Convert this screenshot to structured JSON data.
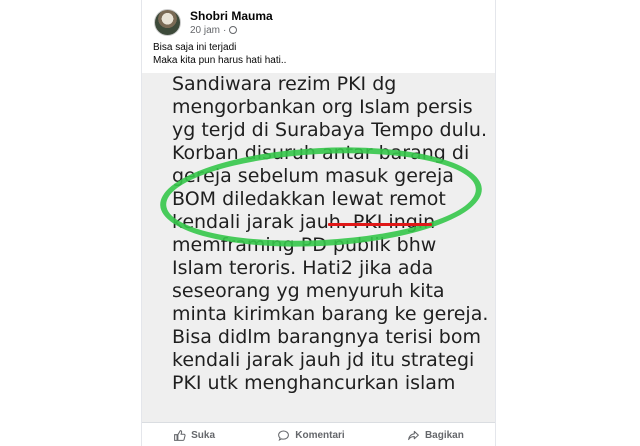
{
  "post": {
    "author": "Shobri Mauma",
    "time": "20 jam",
    "separator": "·",
    "caption_lines": [
      "Bisa saja ini terjadi",
      "Maka kita pun harus hati hati.."
    ]
  },
  "photo": {
    "lines": [
      "Sandiwara rezim PKI dg",
      "mengorbankan org Islam persis",
      "yg terjd di Surabaya Tempo dulu.",
      "Korban disuruh antar barang di",
      "gereja sebelum masuk gereja",
      "BOM diledakkan lewat remot",
      "kendali jarak jauh. PKI ingin",
      "memframing PD publik bhw",
      "Islam teroris. Hati2 jika ada",
      "seseorang yg menyuruh kita",
      "minta kirimkan barang ke gereja.",
      "Bisa didlm  barangnya terisi bom",
      "kendali jarak jauh jd itu strategi",
      "PKI utk menghancurkan islam"
    ],
    "ellipse_color": "#35c64a",
    "underline_color": "#e01818"
  },
  "actions": {
    "like": "Suka",
    "comment": "Komentari",
    "share": "Bagikan"
  }
}
